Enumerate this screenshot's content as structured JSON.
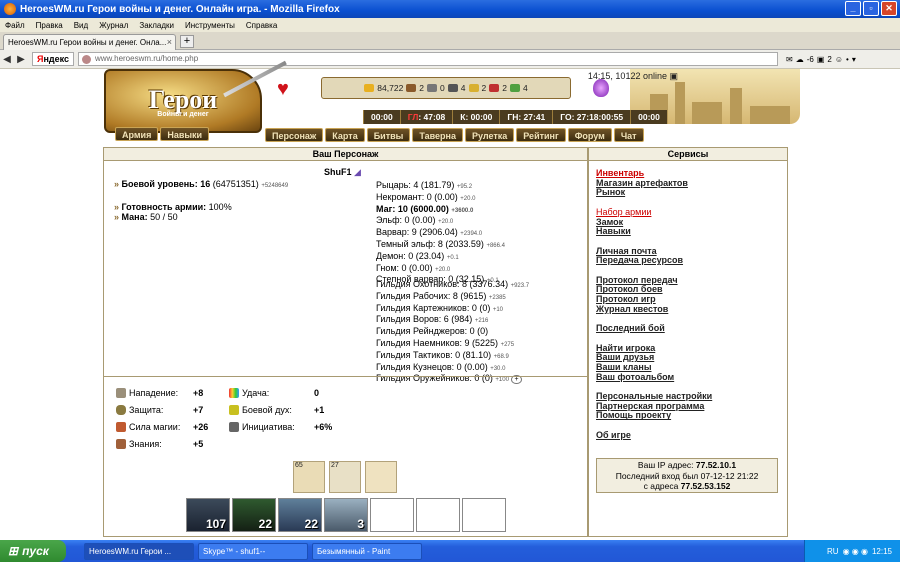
{
  "window": {
    "title": "HeroesWM.ru Герои войны и денег. Онлайн игра. - Mozilla Firefox"
  },
  "menubar": [
    "Файл",
    "Правка",
    "Вид",
    "Журнал",
    "Закладки",
    "Инструменты",
    "Справка"
  ],
  "tab": {
    "label": "HeroesWM.ru Герои войны и денег. Онла..."
  },
  "nav": {
    "yandex": "ндекс",
    "yandex_first": "Я",
    "url": "www.heroeswm.ru/home.php",
    "weather": "-6",
    "count": "2"
  },
  "game": {
    "logo_title": "Герои",
    "logo_sub": "Войны и денег",
    "online": "14:15, 10122 online",
    "resources": [
      "84,722",
      "2",
      "0",
      "4",
      "2",
      "2",
      "4"
    ],
    "timers": [
      {
        "v": "00:00"
      },
      {
        "pre": "ГЛ",
        "v": ": 47:08"
      },
      {
        "v": "К: 00:00"
      },
      {
        "v": "ГН: 27:41"
      },
      {
        "v": "ГО: 27:18:00:55"
      },
      {
        "v": "00:00"
      }
    ],
    "nav_left": [
      "Армия",
      "Навыки"
    ],
    "nav_main": [
      "Персонаж",
      "Карта",
      "Битвы",
      "Таверна",
      "Рулетка",
      "Рейтинг",
      "Форум",
      "Чат"
    ]
  },
  "character": {
    "header": "Ваш Персонаж",
    "name": "ShuF1",
    "level_label": "Боевой уровень:",
    "level": "16",
    "level_exp": "(64751351)",
    "level_plus": "+5248649",
    "ready_label": "Готовность армии:",
    "ready": "100%",
    "mana_label": "Мана:",
    "mana": "50 / 50",
    "factions": [
      {
        "t": "Рыцарь: 4 (181.79)",
        "p": "+95.2",
        "b": false
      },
      {
        "t": "Некромант: 0 (0.00)",
        "p": "+20.0",
        "b": false
      },
      {
        "t": "Маг: 10 (6000.00)",
        "p": "+3600.0",
        "b": true
      },
      {
        "t": "Эльф: 0 (0.00)",
        "p": "+20.0",
        "b": false
      },
      {
        "t": "Варвар: 9 (2906.04)",
        "p": "+2394.0",
        "b": false
      },
      {
        "t": "Темный эльф: 8 (2033.59)",
        "p": "+866.4",
        "b": false
      },
      {
        "t": "Демон: 0 (23.04)",
        "p": "+0.1",
        "b": false
      },
      {
        "t": "Гном: 0 (0.00)",
        "p": "+20.0",
        "b": false
      },
      {
        "t": "Степной варвар: 0 (32.15)",
        "p": "+0.1",
        "b": false
      }
    ],
    "guilds": [
      {
        "t": "Гильдия Охотников: 8 (3376.34)",
        "p": "+923.7"
      },
      {
        "t": "Гильдия Рабочих: 8 (9615)",
        "p": "+2385"
      },
      {
        "t": "Гильдия Картежников: 0 (0)",
        "p": "+10"
      },
      {
        "t": "Гильдия Воров: 6 (984)",
        "p": "+216"
      },
      {
        "t": "Гильдия Рейнджеров: 0 (0)",
        "p": ""
      },
      {
        "t": "Гильдия Наемников: 9 (5225)",
        "p": "+275"
      },
      {
        "t": "Гильдия Тактиков: 0 (81.10)",
        "p": "+68.9"
      },
      {
        "t": "Гильдия Кузнецов: 0 (0.00)",
        "p": "+30.0"
      },
      {
        "t": "Гильдия Оружейников: 0 (0)",
        "p": "+100"
      }
    ],
    "guild_plus": "+",
    "stats": {
      "attack_label": "Нападение:",
      "attack": "+8",
      "defense_label": "Защита:",
      "defense": "+7",
      "spell_label": "Сила магии:",
      "spell": "+26",
      "know_label": "Знания:",
      "know": "+5",
      "luck_label": "Удача:",
      "luck": "0",
      "morale_label": "Боевой дух:",
      "morale": "+1",
      "init_label": "Инициатива:",
      "init": "+6%"
    },
    "artifacts": [
      "65",
      "27",
      ""
    ],
    "army": [
      "107",
      "22",
      "22",
      "3",
      "",
      "",
      ""
    ]
  },
  "services": {
    "header": "Сервисы",
    "groups": [
      [
        "Инвентарь",
        "Магазин артефактов",
        "Рынок"
      ],
      [
        "Набор армии",
        "Замок",
        "Навыки"
      ],
      [
        "Личная почта",
        "Передача ресурсов"
      ],
      [
        "Протокол передач",
        "Протокол боев",
        "Протокол игр",
        "Журнал квестов"
      ],
      [
        "Последний бой"
      ],
      [
        "Найти игрока",
        "Ваши друзья",
        "Ваши кланы",
        "Ваш фотоальбом"
      ],
      [
        "Персональные настройки",
        "Партнерская программа",
        "Помощь проекту"
      ],
      [
        "Об игре"
      ]
    ],
    "ip_label": "Ваш IP адрес:",
    "ip": "77.52.10.1",
    "last_label": "Последний вход был 07-12-12 21:22",
    "from_label": "с адреса",
    "from_ip": "77.52.53.152"
  },
  "taskbar": {
    "start": "пуск",
    "items": [
      "HeroesWM.ru Герои ...",
      "Skype™ - shuf1--",
      "Безымянный - Paint"
    ],
    "lang": "RU",
    "time": "12:15"
  },
  "colors": {
    "title_blue": "#0a4fd0",
    "link_red": "#c00",
    "panel_border": "#a89a72",
    "nav_brown": "#4a3b1f"
  }
}
